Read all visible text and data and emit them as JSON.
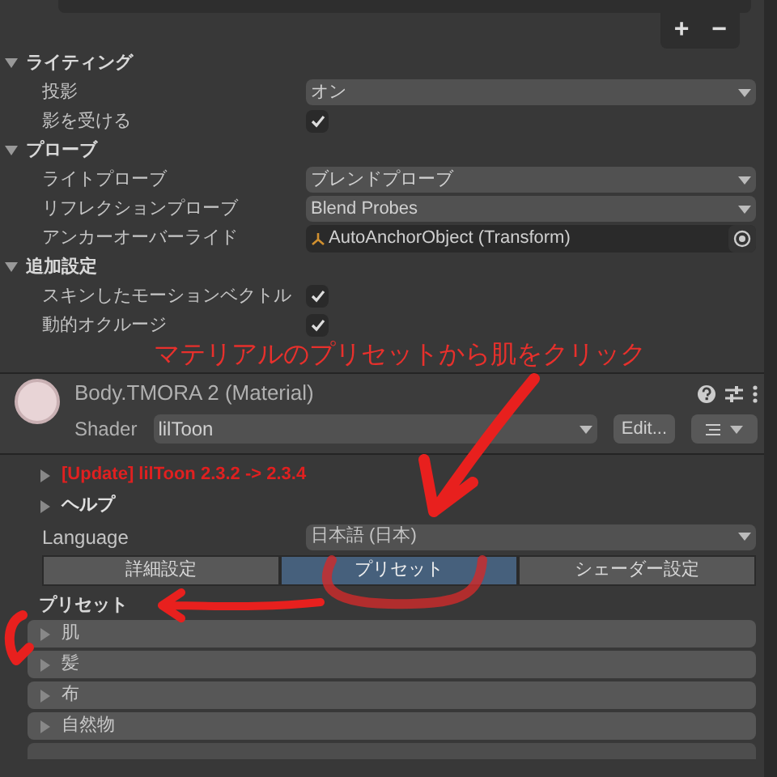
{
  "list_buttons": [
    "+",
    "−"
  ],
  "sections": [
    {
      "title": "ライティング",
      "expanded": true,
      "rows": [
        {
          "label": "投影",
          "kind": "dropdown",
          "value": "オン"
        },
        {
          "label": "影を受ける",
          "kind": "checkbox",
          "checked": true
        }
      ]
    },
    {
      "title": "プローブ",
      "expanded": true,
      "rows": [
        {
          "label": "ライトプローブ",
          "kind": "dropdown",
          "value": "ブレンドプローブ"
        },
        {
          "label": "リフレクションプローブ",
          "kind": "dropdown",
          "value": "Blend Probes"
        },
        {
          "label": "アンカーオーバーライド",
          "kind": "object",
          "value": "AutoAnchorObject (Transform)"
        }
      ]
    },
    {
      "title": "追加設定",
      "expanded": true,
      "rows": [
        {
          "label": "スキンしたモーションベクトル",
          "kind": "checkbox",
          "checked": true
        },
        {
          "label": "動的オクルージ",
          "kind": "checkbox",
          "checked": true
        }
      ]
    }
  ],
  "annotation": "マテリアルのプリセットから肌をクリック",
  "material": {
    "title": "Body.TMORA 2 (Material)",
    "shader_label": "Shader",
    "shader": "lilToon",
    "edit_button": "Edit..."
  },
  "foldouts": [
    {
      "label": "[Update] lilToon 2.3.2 -> 2.3.4",
      "kind": "warning",
      "expanded": false
    },
    {
      "label": "ヘルプ",
      "kind": "normal",
      "expanded": false
    }
  ],
  "language": {
    "label": "Language",
    "value": "日本語 (日本)"
  },
  "tabs": [
    {
      "label": "詳細設定",
      "selected": false
    },
    {
      "label": "プリセット",
      "selected": true
    },
    {
      "label": "シェーダー設定",
      "selected": false
    }
  ],
  "presets": {
    "title": "プリセット",
    "items": [
      {
        "label": "肌",
        "expanded": false
      },
      {
        "label": "髪",
        "expanded": false
      },
      {
        "label": "布",
        "expanded": false
      },
      {
        "label": "自然物",
        "expanded": false
      }
    ]
  }
}
